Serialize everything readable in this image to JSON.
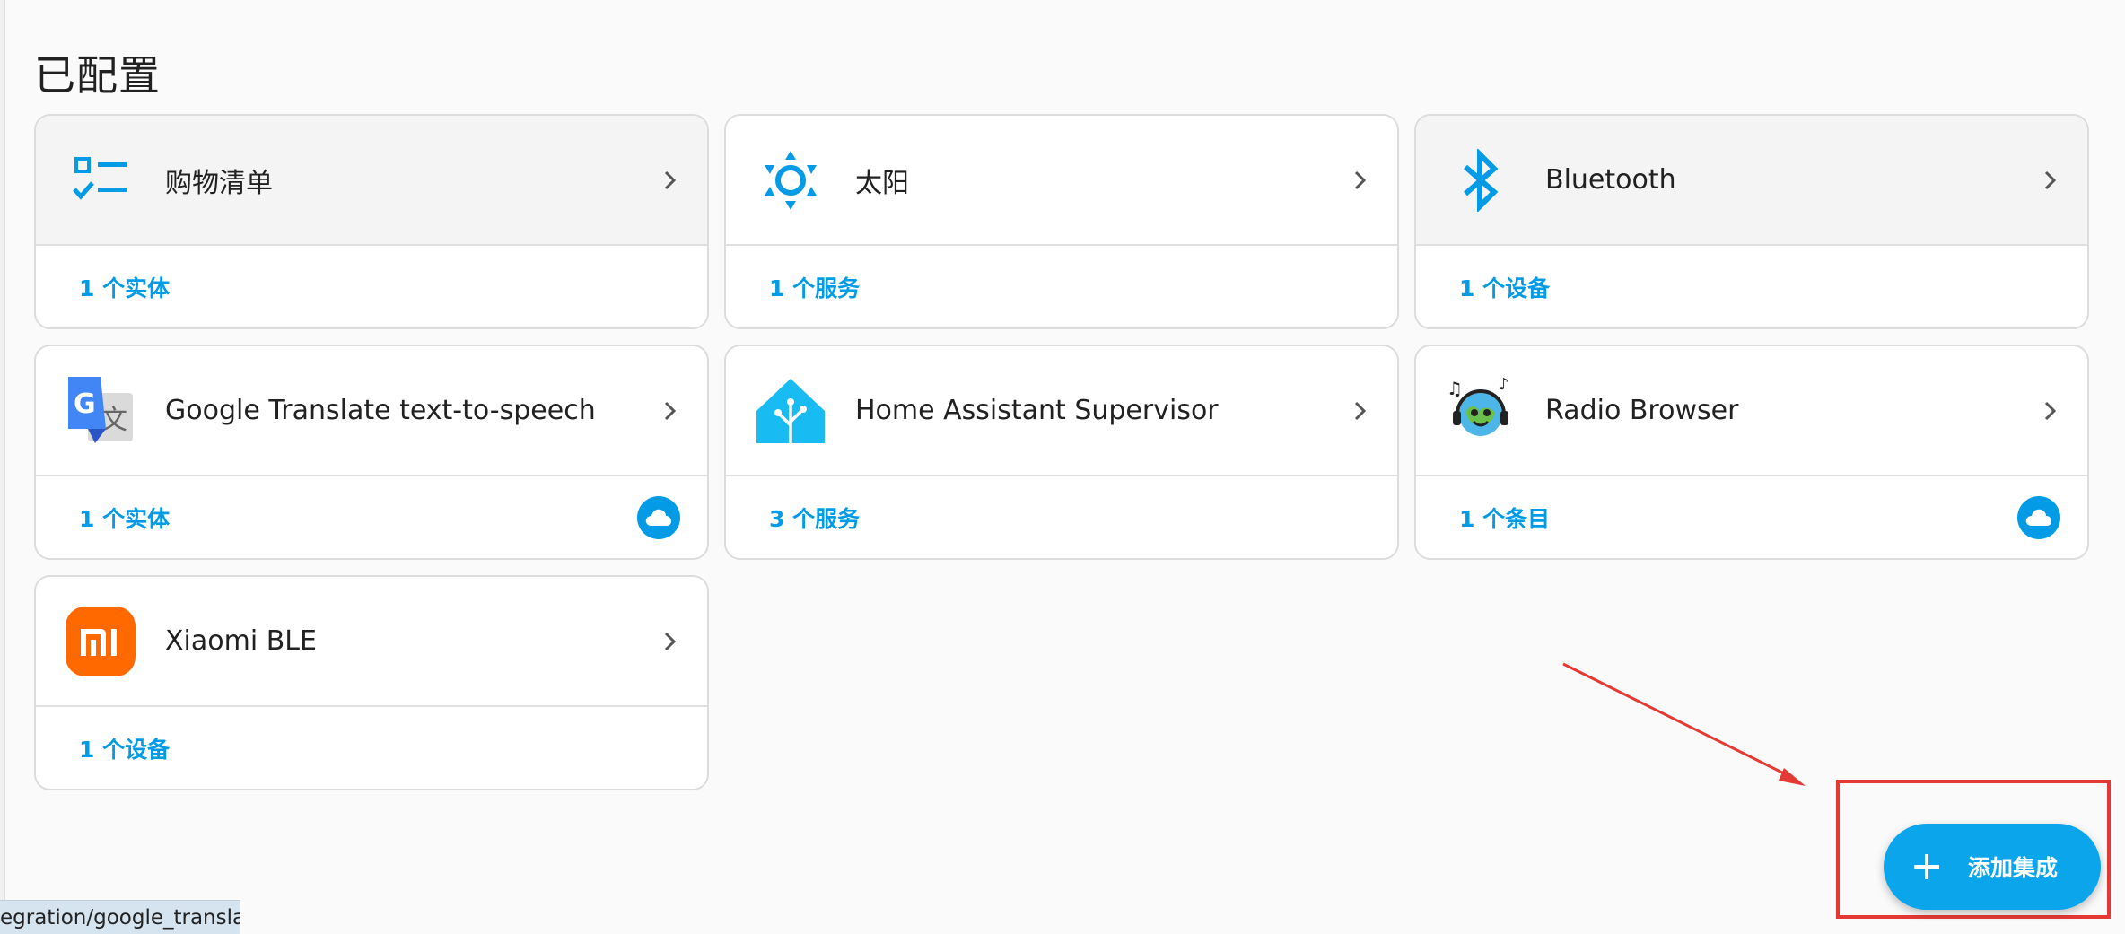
{
  "page": {
    "title": "已配置"
  },
  "integrations": [
    {
      "name": "购物清单",
      "link": "1 个实体",
      "icon": "checklist-icon",
      "cloud": false
    },
    {
      "name": "太阳",
      "link": "1 个服务",
      "icon": "sun-icon",
      "cloud": false
    },
    {
      "name": "Bluetooth",
      "link": "1 个设备",
      "icon": "bluetooth-icon",
      "cloud": false
    },
    {
      "name": "Google Translate text-to-speech",
      "link": "1 个实体",
      "icon": "google-translate-icon",
      "cloud": true
    },
    {
      "name": "Home Assistant Supervisor",
      "link": "3 个服务",
      "icon": "home-assistant-icon",
      "cloud": false
    },
    {
      "name": "Radio Browser",
      "link": "1 个条目",
      "icon": "radio-browser-icon",
      "cloud": true
    },
    {
      "name": "Xiaomi BLE",
      "link": "1 个设备",
      "icon": "xiaomi-icon",
      "cloud": false
    }
  ],
  "fab": {
    "label": "添加集成",
    "icon": "plus-icon"
  },
  "status_bar": {
    "url": "egration/google_transla"
  },
  "colors": {
    "accent": "#039be5",
    "fab": "#0ba5ec",
    "annotation": "#e53935",
    "xiaomi": "#ff6900"
  }
}
